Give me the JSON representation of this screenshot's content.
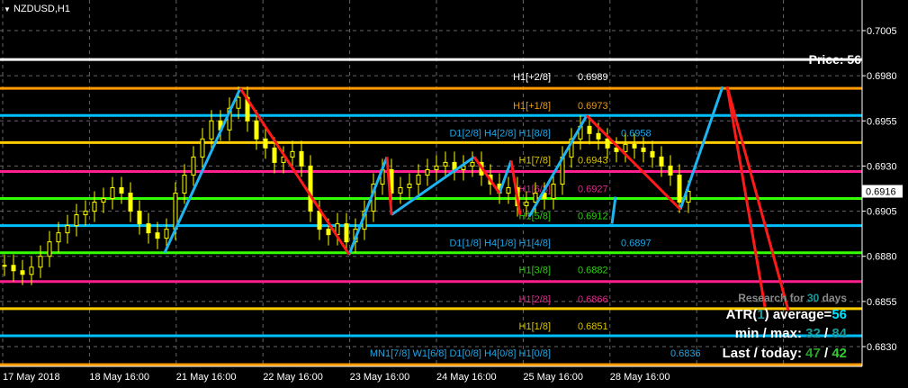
{
  "header": {
    "symbol_title": "NZDUSD,H1",
    "menu_icon": "triangle-down-icon"
  },
  "chart_data": {
    "type": "candlestick",
    "symbol": "NZDUSD",
    "timeframe": "H1",
    "ylim": [
      0.6816,
      0.7021
    ],
    "y_ticks": [
      "0.7005",
      "0.6980",
      "0.6955",
      "0.6930",
      "0.6905",
      "0.6880",
      "0.6855",
      "0.6830"
    ],
    "x_ticks": [
      "17 May 2018",
      "18 May 16:00",
      "21 May 16:00",
      "22 May 16:00",
      "23 May 16:00",
      "24 May 16:00",
      "25 May 16:00",
      "28 May 16:00"
    ],
    "current_price": "0.6916",
    "closes": [
      0.6875,
      0.6872,
      0.687,
      0.6874,
      0.688,
      0.6888,
      0.6893,
      0.6897,
      0.6903,
      0.6905,
      0.691,
      0.6912,
      0.6918,
      0.6915,
      0.6905,
      0.6898,
      0.6893,
      0.689,
      0.6895,
      0.6915,
      0.6925,
      0.6935,
      0.6945,
      0.6955,
      0.695,
      0.6962,
      0.6968,
      0.6955,
      0.6945,
      0.694,
      0.6932,
      0.6935,
      0.6938,
      0.693,
      0.6905,
      0.6895,
      0.6892,
      0.6898,
      0.6888,
      0.6895,
      0.6905,
      0.692,
      0.6928,
      0.6915,
      0.6918,
      0.692,
      0.6925,
      0.6928,
      0.693,
      0.6932,
      0.6928,
      0.693,
      0.6932,
      0.6925,
      0.692,
      0.6915,
      0.6918,
      0.6908,
      0.691,
      0.6915,
      0.6912,
      0.692,
      0.6935,
      0.6945,
      0.6952,
      0.6948,
      0.6945,
      0.694,
      0.6938,
      0.6942,
      0.694,
      0.6938,
      0.6935,
      0.693,
      0.6925,
      0.691,
      0.6916
    ],
    "levels": [
      {
        "price": 0.6989,
        "tag": "H1[+2/8]",
        "value": "0.6989",
        "color": "#ffffff",
        "text_color": "#ffffff"
      },
      {
        "price": 0.6973,
        "tag": "H1[+1/8]",
        "value": "0.6973",
        "color": "#ff9900",
        "text_color": "#e39a1a"
      },
      {
        "price": 0.6958,
        "tag": "D1[2/8] H4[2/8] H1[8/8]",
        "value": "0.6958",
        "color": "#00bfff",
        "text_color": "#1fa6e6"
      },
      {
        "price": 0.6943,
        "tag": "H1[7/8]",
        "value": "0.6943",
        "color": "#ffcc00",
        "text_color": "#d9c400"
      },
      {
        "price": 0.6927,
        "tag": "H1[6/8]",
        "value": "0.6927",
        "color": "#ff1f8f",
        "text_color": "#d82c8a"
      },
      {
        "price": 0.6912,
        "tag": "H1[5/8]",
        "value": "0.6912",
        "color": "#33ff00",
        "text_color": "#2fcc14"
      },
      {
        "price": 0.6897,
        "tag": "D1[1/8] H4[1/8] H1[4/8]",
        "value": "0.6897",
        "color": "#00bfff",
        "text_color": "#1fa6e6"
      },
      {
        "price": 0.6882,
        "tag": "H1[3/8]",
        "value": "0.6882",
        "color": "#33ff00",
        "text_color": "#2fcc14"
      },
      {
        "price": 0.6866,
        "tag": "H1[2/8]",
        "value": "0.6866",
        "color": "#ff1f8f",
        "text_color": "#d82c8a"
      },
      {
        "price": 0.6851,
        "tag": "H1[1/8]",
        "value": "0.6851",
        "color": "#ffcc00",
        "text_color": "#d9c400"
      },
      {
        "price": 0.6836,
        "tag": "MN1[7/8] W1[6/8] D1[0/8] H4[0/8] H1[0/8]",
        "value": "0.6836",
        "color": "#00bfff",
        "text_color": "#1fa6e6"
      },
      {
        "price": 0.682,
        "tag": "",
        "value": "",
        "color": "#ff9900",
        "text_color": "#ff9900"
      }
    ],
    "zigzag_blue": [
      [
        [
          17.8,
          0.6882
        ],
        [
          26.2,
          0.6973
        ]
      ],
      [
        [
          38.3,
          0.6881
        ],
        [
          42.5,
          0.6935
        ]
      ],
      [
        [
          43,
          0.6903
        ],
        [
          52.2,
          0.6935
        ]
      ],
      [
        [
          55,
          0.6915
        ],
        [
          56.3,
          0.6933
        ]
      ],
      [
        [
          58.3,
          0.6902
        ],
        [
          64.7,
          0.6958
        ]
      ],
      [
        [
          67.5,
          0.6898
        ],
        [
          67.9,
          0.6913
        ]
      ],
      [
        [
          75.1,
          0.6906
        ],
        [
          79.8,
          0.6974
        ]
      ]
    ],
    "zigzag_red": [
      [
        [
          26.2,
          0.6973
        ],
        [
          38.3,
          0.6881
        ]
      ],
      [
        [
          42.5,
          0.6935
        ],
        [
          43,
          0.6903
        ]
      ],
      [
        [
          52.2,
          0.6935
        ],
        [
          55,
          0.6915
        ]
      ],
      [
        [
          56.3,
          0.6933
        ],
        [
          57.3,
          0.6903
        ]
      ],
      [
        [
          64.7,
          0.6958
        ],
        [
          75.1,
          0.6906
        ]
      ],
      [
        [
          80.3,
          0.6974
        ],
        [
          87.1,
          0.685
        ]
      ],
      [
        [
          80.3,
          0.6974
        ],
        [
          84.5,
          0.6852
        ]
      ]
    ],
    "info": {
      "price_label": "Price: 56",
      "research_prefix": "Research for ",
      "research_days": "30",
      "research_suffix": " days",
      "atr_prefix": "ATR(",
      "atr_period": "1",
      "atr_mid": ") average=",
      "atr_avg": "56",
      "minmax_label": "min / max: ",
      "min": "32",
      "sep": " / ",
      "max": "84",
      "last_label": "Last / today: ",
      "last": "47",
      "today": "42"
    }
  }
}
